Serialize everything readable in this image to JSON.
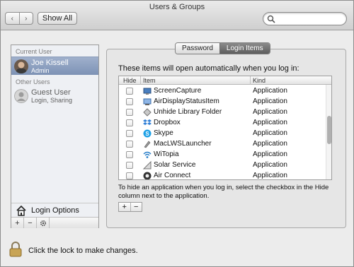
{
  "window": {
    "title": "Users & Groups",
    "nav": {
      "back": "‹",
      "forward": "›"
    },
    "show_all": "Show All",
    "search": {
      "value": "",
      "placeholder": ""
    }
  },
  "sidebar": {
    "current_user_label": "Current User",
    "current_user": {
      "name": "Joe Kissell",
      "role": "Admin"
    },
    "other_users_label": "Other Users",
    "other_users": [
      {
        "name": "Guest User",
        "role": "Login, Sharing"
      }
    ],
    "login_options": "Login Options",
    "buttons": {
      "add": "+",
      "remove": "−"
    }
  },
  "tabs": {
    "password": "Password",
    "login_items": "Login Items",
    "active": "login_items"
  },
  "main": {
    "intro": "These items will open automatically when you log in:",
    "columns": {
      "hide": "Hide",
      "item": "Item",
      "kind": "Kind"
    },
    "items": [
      {
        "name": "ScreenCapture",
        "kind": "Application",
        "icon": "screen-capture-icon"
      },
      {
        "name": "AirDisplayStatusItem",
        "kind": "Application",
        "icon": "air-display-icon"
      },
      {
        "name": "Unhide Library Folder",
        "kind": "Application",
        "icon": "unhide-library-icon"
      },
      {
        "name": "Dropbox",
        "kind": "Application",
        "icon": "dropbox-icon"
      },
      {
        "name": "Skype",
        "kind": "Application",
        "icon": "skype-icon"
      },
      {
        "name": "MacLWSLauncher",
        "kind": "Application",
        "icon": "maclws-launcher-icon"
      },
      {
        "name": "WiTopia",
        "kind": "Application",
        "icon": "witopia-icon"
      },
      {
        "name": "Solar Service",
        "kind": "Application",
        "icon": "solar-service-icon"
      },
      {
        "name": "Air Connect",
        "kind": "Application",
        "icon": "air-connect-icon"
      }
    ],
    "hint": "To hide an application when you log in, select the checkbox in the Hide column next to the application.",
    "add": "+",
    "remove": "−"
  },
  "footer": {
    "lock_text": "Click the lock to make changes."
  },
  "colors": {
    "selection": "#8ea0c0",
    "window_bg": "#ececec"
  }
}
